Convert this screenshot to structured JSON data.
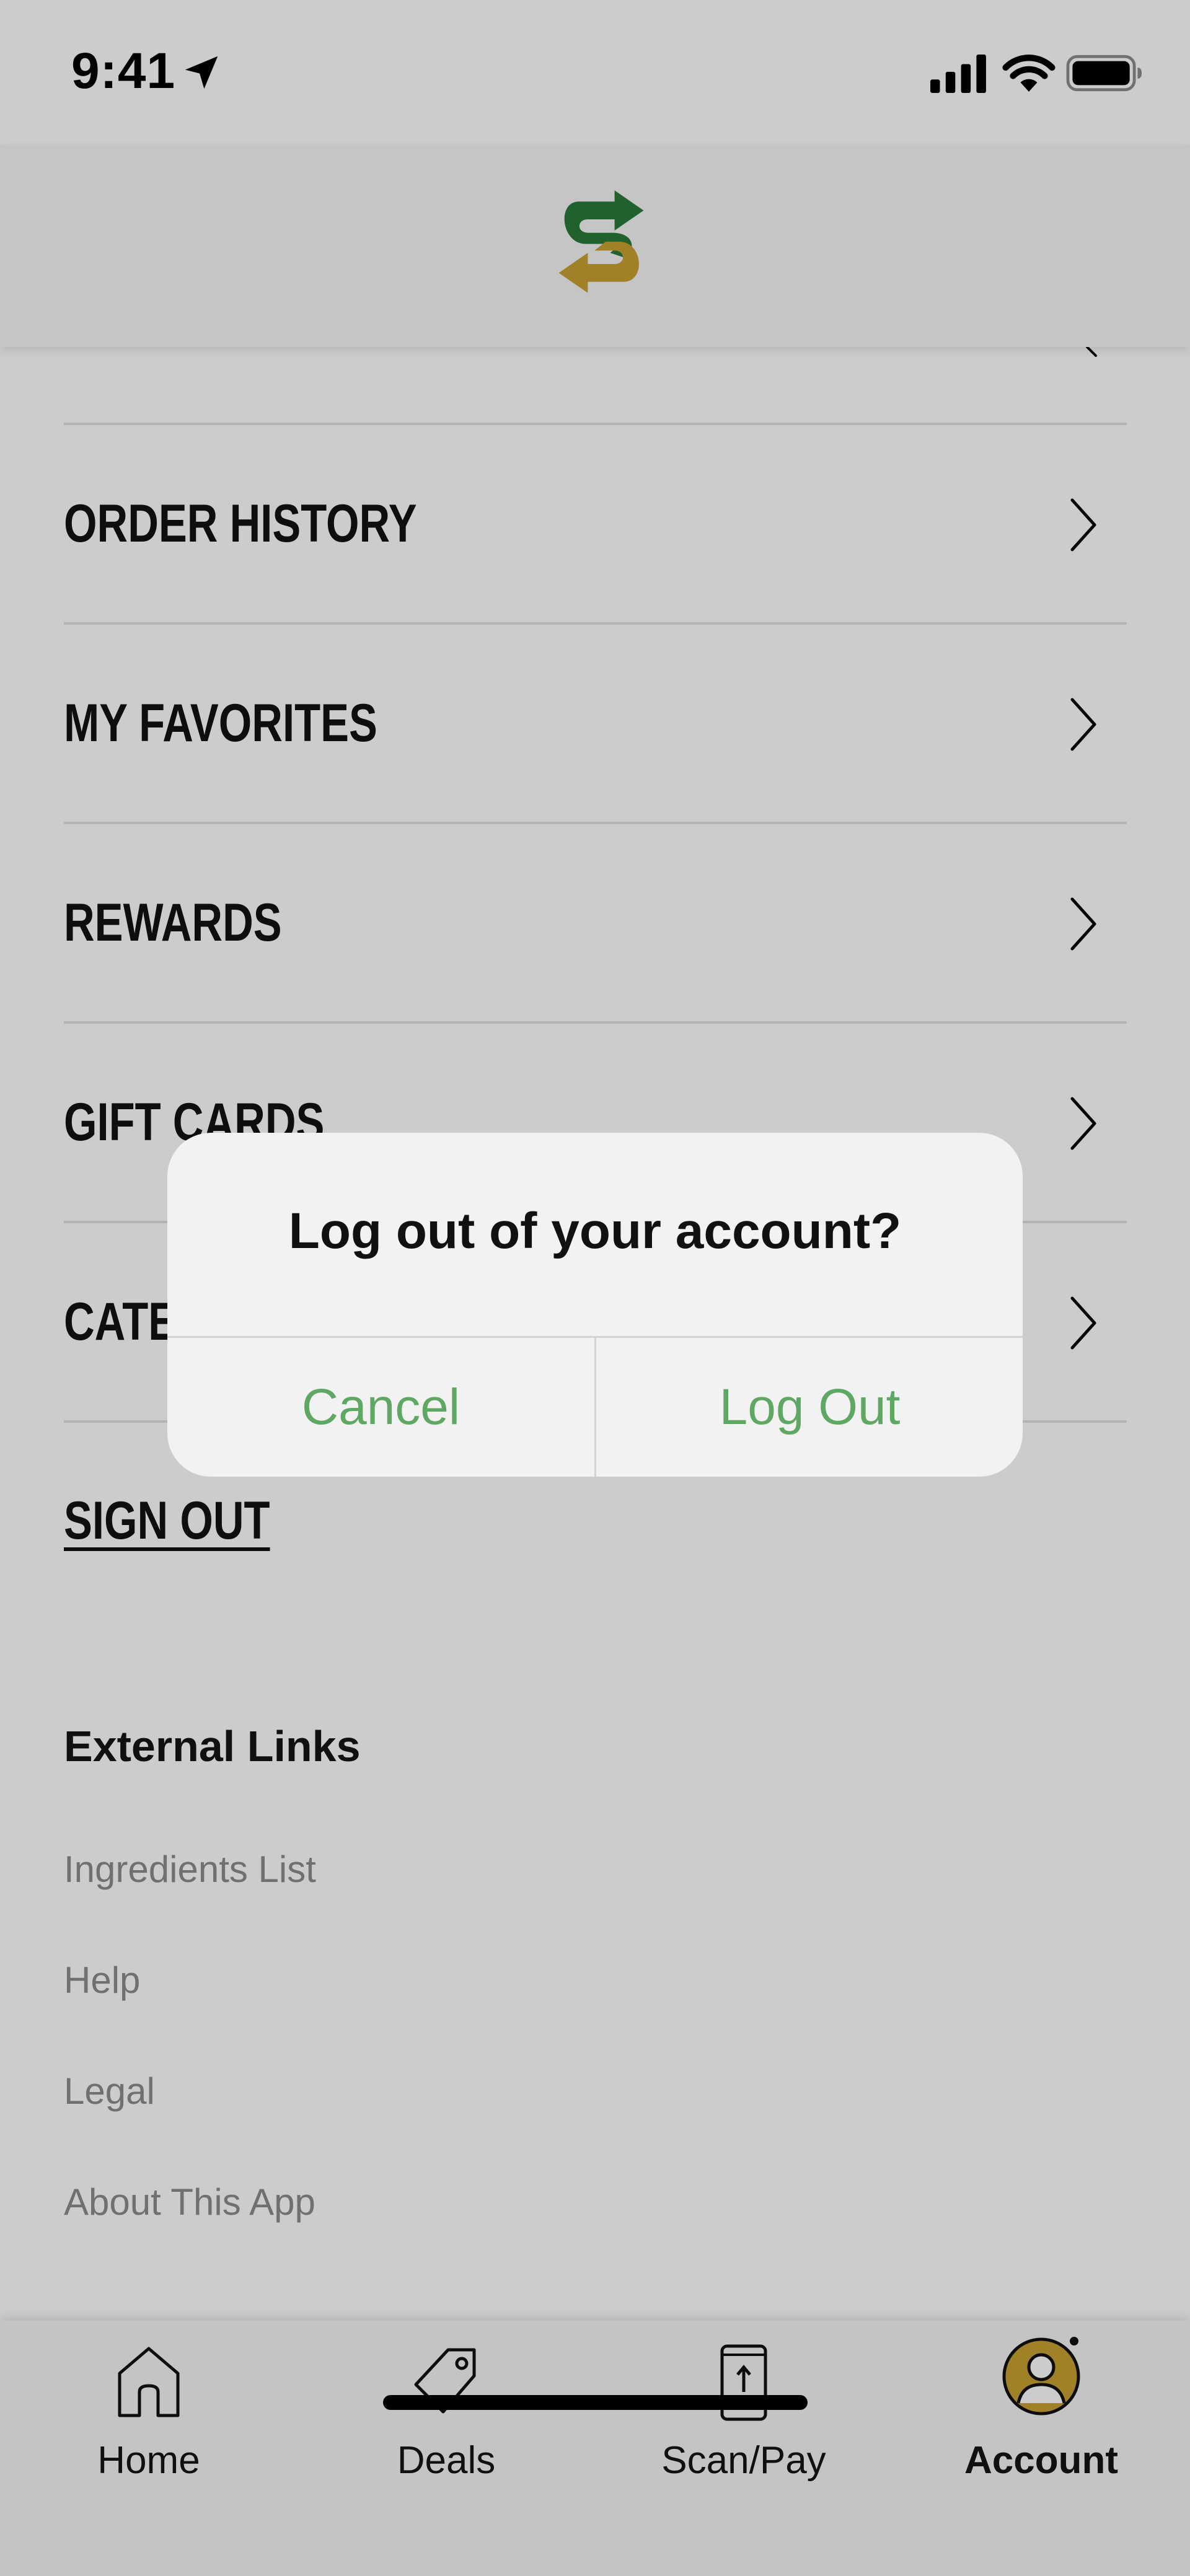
{
  "status_bar": {
    "time": "9:41"
  },
  "menu": {
    "items": [
      {
        "label": "ORDER HISTORY"
      },
      {
        "label": "MY FAVORITES"
      },
      {
        "label": "REWARDS"
      },
      {
        "label": "GIFT CARDS"
      },
      {
        "label": "CATERING"
      }
    ],
    "sign_out_label": "SIGN OUT"
  },
  "external_links": {
    "title": "External Links",
    "items": [
      "Ingredients List",
      "Help",
      "Legal",
      "About This App"
    ]
  },
  "tab_bar": {
    "tabs": [
      {
        "label": "Home",
        "icon": "home-icon"
      },
      {
        "label": "Deals",
        "icon": "tag-icon"
      },
      {
        "label": "Scan/Pay",
        "icon": "phone-scan-icon"
      },
      {
        "label": "Account",
        "icon": "account-avatar-icon",
        "active": true
      }
    ]
  },
  "dialog": {
    "title": "Log out of your account?",
    "cancel_label": "Cancel",
    "confirm_label": "Log Out"
  },
  "colors": {
    "brand_green": "#2a7a3a",
    "brand_yellow": "#c9a232",
    "dialog_button": "#5ea863"
  }
}
